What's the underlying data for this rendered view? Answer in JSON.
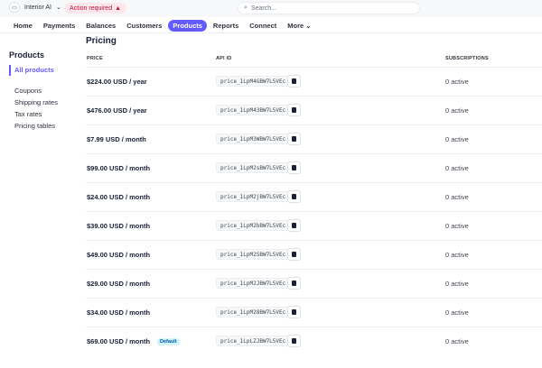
{
  "topbar": {
    "account": "Interior AI",
    "action_required": "Action required",
    "search_placeholder": "Search..."
  },
  "nav": [
    "Home",
    "Payments",
    "Balances",
    "Customers",
    "Products",
    "Reports",
    "Connect",
    "More"
  ],
  "sidebar": {
    "title": "Products",
    "active": "All products",
    "items": [
      "Coupons",
      "Shipping rates",
      "Tax rates",
      "Pricing tables"
    ]
  },
  "main": {
    "title": "Pricing",
    "headers": {
      "price": "PRICE",
      "api_id": "API ID",
      "subscriptions": "SUBSCRIPTIONS"
    },
    "rows": [
      {
        "price": "$224.00 USD / year",
        "api_id": "price_1LpM4GBW7L5VEc",
        "subs": "0 active"
      },
      {
        "price": "$476.00 USD / year",
        "api_id": "price_1LpM43BW7L5VEc",
        "subs": "0 active"
      },
      {
        "price": "$7.99 USD / month",
        "api_id": "price_1LpM3WBW7L5VEc",
        "subs": "0 active"
      },
      {
        "price": "$99.00 USD / month",
        "api_id": "price_1LpM2sBW7L5VEc",
        "subs": "0 active"
      },
      {
        "price": "$24.00 USD / month",
        "api_id": "price_1LpM2jBW7L5VEc",
        "subs": "0 active"
      },
      {
        "price": "$39.00 USD / month",
        "api_id": "price_1LpM2bBW7L5VEc",
        "subs": "0 active"
      },
      {
        "price": "$49.00 USD / month",
        "api_id": "price_1LpM2SBW7L5VEc",
        "subs": "0 active"
      },
      {
        "price": "$29.00 USD / month",
        "api_id": "price_1LpM2JBW7L5VEc",
        "subs": "0 active"
      },
      {
        "price": "$34.00 USD / month",
        "api_id": "price_1LpM28BW7L5VEc",
        "subs": "0 active"
      },
      {
        "price": "$69.00 USD / month",
        "badge": "Default",
        "api_id": "price_1LpLZJBW7L5VEc",
        "subs": "0 active"
      }
    ]
  }
}
